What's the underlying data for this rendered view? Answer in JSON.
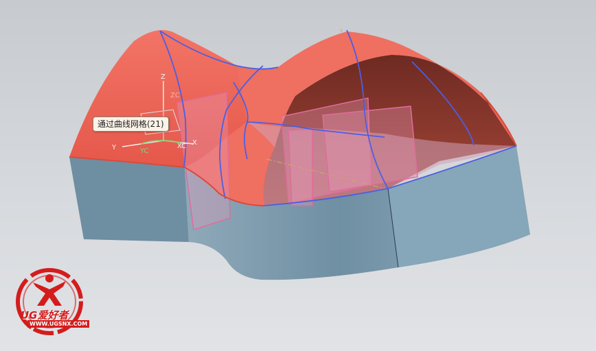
{
  "viewport": {
    "background_color": "#d3d6db"
  },
  "model": {
    "surface_color": "#ee6b5d",
    "inner_surface_color": "#8e3a30",
    "wall_color": "#7d9cb0",
    "edge_color": "#4a5fe0",
    "plane_color": "#e07aa0"
  },
  "tooltip": {
    "text": "通过曲线网格(21)"
  },
  "triad": {
    "labels": {
      "x": "X",
      "xc": "XC",
      "y": "Y",
      "yc": "YC",
      "z": "Z",
      "zc": "ZC"
    }
  },
  "watermark": {
    "brand": "UG爱好者",
    "url": "WWW.UGSNX.COM"
  }
}
